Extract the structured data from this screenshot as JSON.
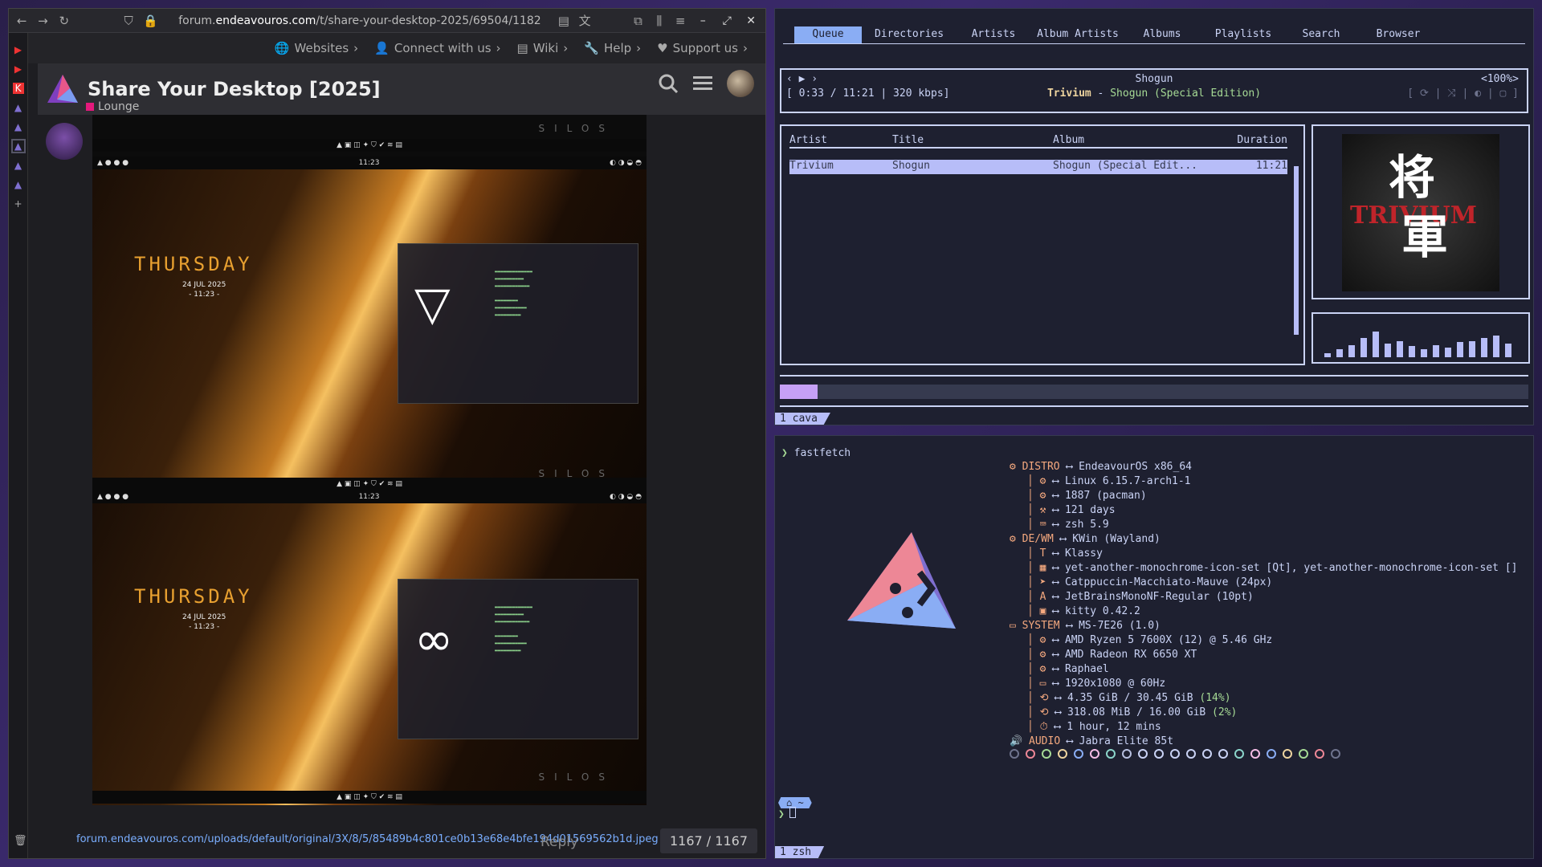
{
  "browser": {
    "url_prefix": "forum.",
    "url_domain": "endeavouros.com",
    "url_path": "/t/share-your-desktop-2025/69504/1182",
    "nav": [
      {
        "label": "Websites",
        "icon": "globe-icon"
      },
      {
        "label": "Connect with us",
        "icon": "user-icon"
      },
      {
        "label": "Wiki",
        "icon": "book-icon"
      },
      {
        "label": "Help",
        "icon": "wrench-icon"
      },
      {
        "label": "Support us",
        "icon": "heart-icon"
      }
    ],
    "topic_title": "Share Your Desktop [2025]",
    "category": "Lounge",
    "shot1": {
      "day": "THURSDAY",
      "date": "24 JUL 2025",
      "time": "- 11:23 -",
      "mark": "SILOS",
      "glyph": "▽"
    },
    "shot2": {
      "day": "THURSDAY",
      "date": "24 JUL 2025",
      "time": "- 11:23 -",
      "mark": "SILOS",
      "glyph": "∞"
    },
    "status_link": "forum.endeavouros.com/uploads/default/original/3X/8/5/85489b4c801ce0b13e68e4bfe194d01569562b1d.jpeg",
    "reply": "Reply",
    "counter": "1167 / 1167"
  },
  "music": {
    "tabs": [
      "Queue",
      "Directories",
      "Artists",
      "Album Artists",
      "Albums",
      "Playlists",
      "Search",
      "Browser"
    ],
    "now_title": "Shogun",
    "time": "[ 0:33 / 11:21 | 320 kbps]",
    "artist": "Trivium",
    "sep": " - ",
    "album_line": "Shogun (Special Edition)",
    "volume": "<100%>",
    "headers": [
      "Artist",
      "Title",
      "Album",
      "Duration"
    ],
    "rows": [
      {
        "artist": "Trivium",
        "title": "Shogun",
        "album": "Shogun (Special Edit...",
        "duration": "11:21"
      }
    ],
    "art_band": "TRIVIUM",
    "art_k1": "将",
    "art_k2": "軍",
    "viz": [
      0.15,
      0.3,
      0.45,
      0.7,
      0.95,
      0.5,
      0.6,
      0.4,
      0.3,
      0.45,
      0.35,
      0.55,
      0.6,
      0.7,
      0.8,
      0.5
    ],
    "progress": 0.05,
    "pane_tab": "1 cava"
  },
  "terminal": {
    "cmd": "fastfetch",
    "prompt": "❯",
    "lines": [
      {
        "label": "DISTRO",
        "value": "EndeavourOS x86_64",
        "head": true
      },
      {
        "value": "Linux 6.15.7-arch1-1"
      },
      {
        "value": "1887 (pacman)"
      },
      {
        "value": "121 days"
      },
      {
        "value": "zsh 5.9"
      },
      {
        "label": "DE/WM",
        "value": "KWin (Wayland)",
        "head": true
      },
      {
        "value": "Klassy"
      },
      {
        "value": "yet-another-monochrome-icon-set [Qt], yet-another-monochrome-icon-set []"
      },
      {
        "value": "Catppuccin-Macchiato-Mauve (24px)"
      },
      {
        "value": "JetBrainsMonoNF-Regular (10pt)"
      },
      {
        "value": "kitty 0.42.2"
      },
      {
        "label": "SYSTEM",
        "value": "MS-7E26 (1.0)",
        "head": true
      },
      {
        "value": "AMD Ryzen 5 7600X (12) @ 5.46 GHz"
      },
      {
        "value": "AMD Radeon RX 6650 XT"
      },
      {
        "value": "Raphael"
      },
      {
        "value": "1920x1080 @ 60Hz"
      },
      {
        "value": "4.35 GiB / 30.45 GiB",
        "pct": "(14%)"
      },
      {
        "value": "318.08 MiB / 16.00 GiB",
        "pct": "(2%)"
      },
      {
        "value": "1 hour, 12 mins"
      },
      {
        "label": "AUDIO",
        "value": "Jabra Elite 85t",
        "head": true
      }
    ],
    "arrow": "⟷",
    "dot_colors": [
      "#6e738d",
      "#ed8796",
      "#a6da95",
      "#eed49f",
      "#8aadf4",
      "#f5bde6",
      "#8bd5ca",
      "#b8c0e0",
      "#cad3f5",
      "#cad3f5",
      "#cad3f5",
      "#cad3f5",
      "#cad3f5",
      "#cad3f5",
      "#8bd5ca",
      "#f5bde6",
      "#8aadf4",
      "#eed49f",
      "#a6da95",
      "#ed8796",
      "#6e738d"
    ],
    "pane_tab": "1 zsh"
  }
}
